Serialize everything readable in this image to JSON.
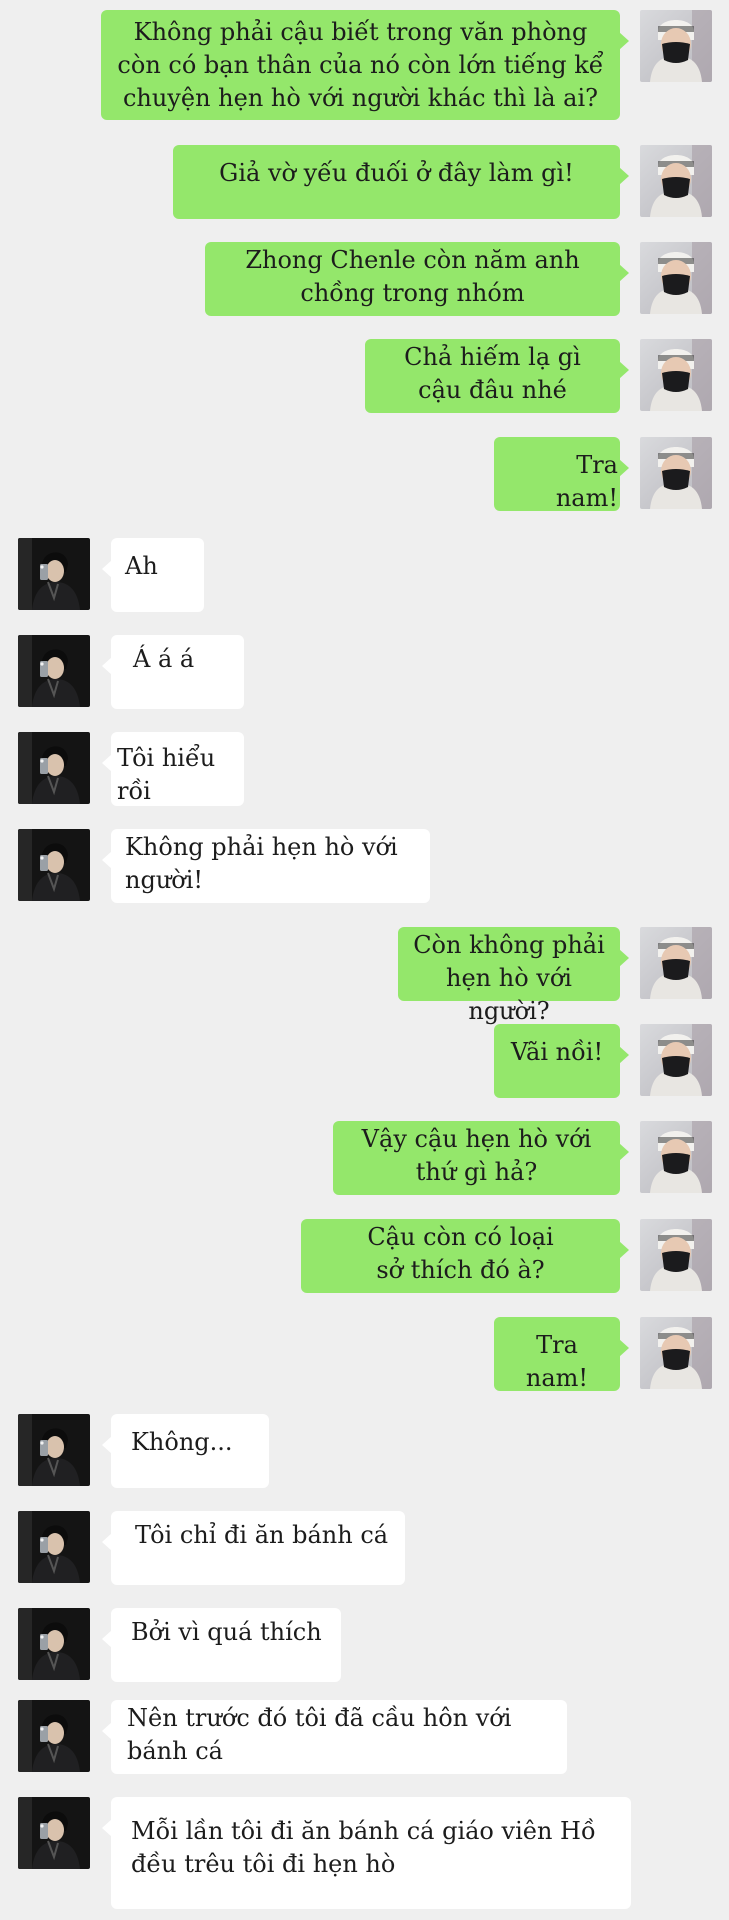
{
  "colors": {
    "background": "#efefef",
    "sent_bubble": "#94e76b",
    "received_bubble": "#ffffff"
  },
  "icons": {
    "me_avatar": "masked-person-avatar",
    "them_avatar": "mirror-selfie-avatar"
  },
  "messages": [
    {
      "side": "me",
      "text": "Không phải cậu biết trong văn phòng\ncòn có bạn thân của nó còn lớn tiếng kể\nchuyện hẹn hò với người khác thì là ai?"
    },
    {
      "side": "me",
      "text": "Giả vờ yếu đuối ở đây làm gì!"
    },
    {
      "side": "me",
      "text": "Zhong Chenle còn năm anh\nchồng trong nhóm"
    },
    {
      "side": "me",
      "text": "Chả hiếm lạ gì\ncậu đâu nhé"
    },
    {
      "side": "me",
      "text": "Tra nam!"
    },
    {
      "side": "them",
      "text": "Ah"
    },
    {
      "side": "them",
      "text": "Á á á"
    },
    {
      "side": "them",
      "text": "Tôi hiểu rồi"
    },
    {
      "side": "them",
      "text": "Không phải hẹn hò với\nngười!"
    },
    {
      "side": "me",
      "text": "Còn không phải\nhẹn hò với người?"
    },
    {
      "side": "me",
      "text": "Vãi nồi!"
    },
    {
      "side": "me",
      "text": "Vậy cậu hẹn hò với\nthứ gì hả?"
    },
    {
      "side": "me",
      "text": "Cậu còn có loại\nsở thích đó à?"
    },
    {
      "side": "me",
      "text": "Tra nam!"
    },
    {
      "side": "them",
      "text": "Không..."
    },
    {
      "side": "them",
      "text": "Tôi chỉ đi ăn bánh cá"
    },
    {
      "side": "them",
      "text": "Bởi vì quá thích"
    },
    {
      "side": "them",
      "text": "Nên trước đó tôi đã cầu hôn với\nbánh cá"
    },
    {
      "side": "them",
      "text": "Mỗi lần tôi đi ăn bánh cá giáo viên Hồ\nđều trêu tôi đi hẹn hò"
    }
  ]
}
